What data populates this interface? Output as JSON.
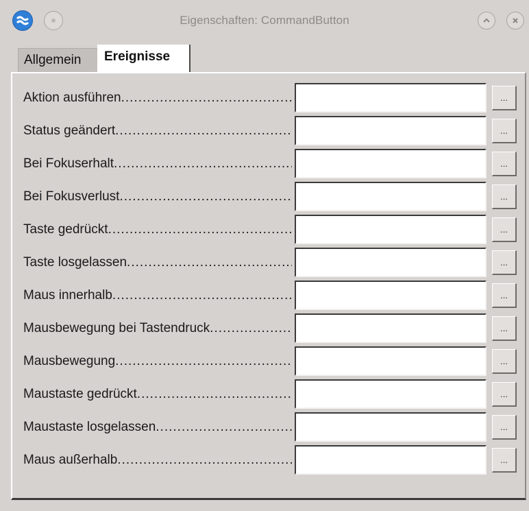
{
  "window": {
    "title": "Eigenschaften: CommandButton"
  },
  "tabs": [
    {
      "label": "Allgemein",
      "active": false
    },
    {
      "label": "Ereignisse",
      "active": true
    }
  ],
  "events": [
    {
      "label": "Aktion ausführen",
      "value": "",
      "button": "..."
    },
    {
      "label": "Status geändert",
      "value": "",
      "button": "..."
    },
    {
      "label": "Bei Fokuserhalt",
      "value": "",
      "button": "..."
    },
    {
      "label": "Bei Fokusverlust",
      "value": "",
      "button": "..."
    },
    {
      "label": "Taste gedrückt",
      "value": "",
      "button": "..."
    },
    {
      "label": "Taste losgelassen",
      "value": "",
      "button": "..."
    },
    {
      "label": "Maus innerhalb",
      "value": "",
      "button": "..."
    },
    {
      "label": "Mausbewegung bei Tastendruck",
      "value": "",
      "button": "..."
    },
    {
      "label": "Mausbewegung",
      "value": "",
      "button": "..."
    },
    {
      "label": "Maustaste gedrückt",
      "value": "",
      "button": "..."
    },
    {
      "label": "Maustaste losgelassen",
      "value": "",
      "button": "..."
    },
    {
      "label": "Maus außerhalb",
      "value": "",
      "button": "..."
    }
  ],
  "icons": {
    "app": "app-logo-icon",
    "pin": "pin-icon",
    "shade": "chevron-up-icon",
    "close": "close-icon"
  },
  "colors": {
    "window_bg": "#d6d2d0",
    "app_icon": "#2f7fd8",
    "title_text": "#8e8a88"
  }
}
